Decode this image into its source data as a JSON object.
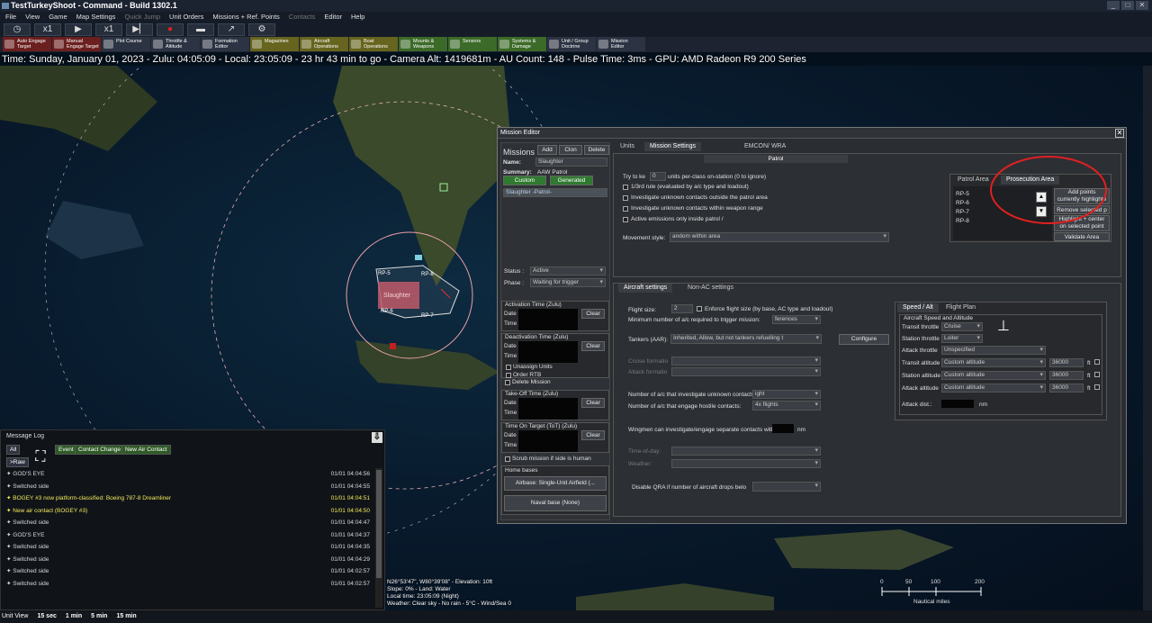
{
  "app": {
    "title": "TestTurkeyShoot - Command - Build 1302.1"
  },
  "menu": [
    "File",
    "View",
    "Game",
    "Map Settings",
    "Quick Jump",
    "Unit Orders",
    "Missions + Ref. Points",
    "Contacts",
    "Editor",
    "Help"
  ],
  "playbar": {
    "speed1": "x1",
    "speed2": "x1"
  },
  "command_buttons": [
    {
      "label": "Auto Engage\nTarget",
      "tone": "red"
    },
    {
      "label": "Manual\nEngage Target",
      "tone": "red"
    },
    {
      "label": "Plot Course",
      "tone": "dk"
    },
    {
      "label": "Throttle &\nAltitude",
      "tone": "dk"
    },
    {
      "label": "Formation\nEditor",
      "tone": "dk"
    },
    {
      "label": "Magazines",
      "tone": "ol"
    },
    {
      "label": "Aircraft\nOperations",
      "tone": "ol"
    },
    {
      "label": "Boat\nOperations",
      "tone": "ol"
    },
    {
      "label": "Mounts &\nWeapons",
      "tone": "gr"
    },
    {
      "label": "Sensors",
      "tone": "gr"
    },
    {
      "label": "Systems &\nDamage",
      "tone": "gr"
    },
    {
      "label": "Unit / Group\nDoctrine",
      "tone": "dk"
    },
    {
      "label": "Mission\nEditor",
      "tone": "dk"
    }
  ],
  "status_line": "Time: Sunday, January 01, 2023 - Zulu: 04:05:09 - Local: 23:05:09 - 23 hr 43 min to go -  Camera Alt: 1419681m  - AU Count: 148 - Pulse Time: 3ms - GPU: AMD Radeon R9 200 Series",
  "map": {
    "zone_label": "Slaughter",
    "rp_labels": [
      "RP-5",
      "RP-8",
      "RP-6",
      "RP-7"
    ],
    "coords": [
      "N26°53'47\", W80°39'08\" - Elevation: 10ft",
      "Slope: 0% - Land: Water",
      "Local time: 23:05:09 (Night)",
      "Weather: Clear sky - No rain - 5°C - Wind/Sea 0"
    ],
    "scale": {
      "ticks": [
        "0",
        "50",
        "100",
        "200"
      ],
      "unit": "Nautical miles"
    }
  },
  "message_log": {
    "title": "Message Log",
    "buttons": {
      "all": "All",
      "raw": ">Raw",
      "event": "Event",
      "contact_change": "Contact Change",
      "new_air": "New Air Contact"
    },
    "entries": [
      {
        "text": "GOD'S EYE",
        "time": "01/01 04:04:56",
        "hl": false
      },
      {
        "text": "Switched side",
        "time": "01/01 04:04:55",
        "hl": false
      },
      {
        "text": "BOGEY #3 now platform-classified: Boeing 787-8 Dreamliner",
        "time": "01/01 04:04:51",
        "hl": true
      },
      {
        "text": "New air contact (BOGEY #3)",
        "time": "01/01 04:04:50",
        "hl": true
      },
      {
        "text": "Switched side",
        "time": "01/01 04:04:47",
        "hl": false
      },
      {
        "text": "GOD'S EYE",
        "time": "01/01 04:04:37",
        "hl": false
      },
      {
        "text": "Switched side",
        "time": "01/01 04:04:35",
        "hl": false
      },
      {
        "text": "Switched side",
        "time": "01/01 04:04:29",
        "hl": false
      },
      {
        "text": "Switched side",
        "time": "01/01 04:02:57",
        "hl": false
      },
      {
        "text": "Switched side",
        "time": "01/01 04:02:57",
        "hl": false
      }
    ]
  },
  "bottom_bar": {
    "unit_view": "Unit View",
    "opts": [
      "15 sec",
      "1 min",
      "5 min",
      "15 min"
    ]
  },
  "mission_editor": {
    "title": "Mission Editor",
    "left": {
      "missions_label": "Missions",
      "add": "Add",
      "clone": "Clon",
      "delete": "Delete",
      "name_label": "Name:",
      "name_value": "Slaughter",
      "summary_label": "Summary:",
      "summary_value": "AAW Patrol",
      "custom": "Custom",
      "generated": "Generated",
      "selected_mission": "Slaughter -Patrol-",
      "status_label": "Status :",
      "status_value": "Active",
      "phase_label": "Phase :",
      "phase_value": "Waiting for trigger",
      "activation": "Activation Time (Zulu)",
      "deactivation": "Deactivation Time (Zulu)",
      "date": "Date",
      "time": "Time",
      "clear": "Clear",
      "unassign": "Unassign Units",
      "order_rtb": "Order RTB",
      "delete_mission": "Delete Mission",
      "takeoff": "Take-Off Time (Zulu)",
      "tot": "Time On Target (ToT) (Zulu)",
      "scrub": "Scrub mission if side is human",
      "home_bases": "Home bases",
      "airbase": "Airbase: Single-Unit Airfield (...",
      "naval": "Naval base (None)"
    },
    "tabs": {
      "units": "Units",
      "settings": "Mission Settings",
      "emcon": "EMCON/ WRA"
    },
    "patrol": {
      "header": "Patrol",
      "try_label": "Try to ke",
      "try_value": "0",
      "try_suffix": "units per-class on-station (0 to ignore)",
      "checks": [
        "1/3rd rule (evaluated by a/c type and loadout)",
        "Investigate unknown contacts outside the patrol area",
        "Investigate unknown contacts within weapon range",
        "Active emissions only inside patrol /"
      ],
      "movement_label": "Movement style:",
      "movement_value": "andom within area",
      "area_tabs": [
        "Patrol Area",
        "Prosecution Area"
      ],
      "rps": [
        "RP-5",
        "RP-6",
        "RP-7",
        "RP-8"
      ],
      "area_btns": [
        "Add points\ncurrently highlighte",
        "Remove  selected p",
        "Highlight + center\non selected point",
        "Validate Area"
      ]
    },
    "aircraft": {
      "tabs": [
        "Aircraft settings",
        "Non-AC settings"
      ],
      "flight_size_label": "Flight size:",
      "flight_size_value": "2",
      "enforce": "Enforce flight size (by base, AC type and loadout)",
      "min_label": "Minimum number of a/c required to trigger mission:",
      "min_value": "ferences",
      "tankers_label": "Tankers (AAR):",
      "tankers_value": "Inherited, Allow, but not tankers refuelling t",
      "configure": "Configure",
      "cruise_label": "Cruise formatio",
      "attack_label": "Attack formatio",
      "invest_label": "Number of a/c that investigate unknown contacts:",
      "invest_value": "ight",
      "engage_label": "Number of a/c that engage hostile contacts:",
      "engage_value": "4x flights",
      "wingmen_label": "Wingmen can investigate/engage separate contacts within",
      "wingmen_unit": "nm",
      "tod_label": "Time-of-day:",
      "weather_label": "Weather:",
      "qra_label": "Disable QRA if number of aircraft drops belo"
    },
    "speed": {
      "tabs": [
        "Speed / Alt",
        "Flight Plan"
      ],
      "group": "Aircraft Speed and Altitude",
      "transit_throttle": "Transit throttle",
      "transit_throttle_value": "Cruise",
      "station_throttle": "Station throttle",
      "station_throttle_value": "Loiter",
      "attack_throttle": "Attack throttle",
      "attack_throttle_value": "Unspecified",
      "transit_alt": "Transit altitude",
      "station_alt": "Station altitude",
      "attack_alt": "Attack altitude",
      "alt_value": "Custom altitude",
      "alt_num": "36000",
      "ft": "ft",
      "attack_dist": "Attack dist.:",
      "nm": "nm"
    }
  }
}
